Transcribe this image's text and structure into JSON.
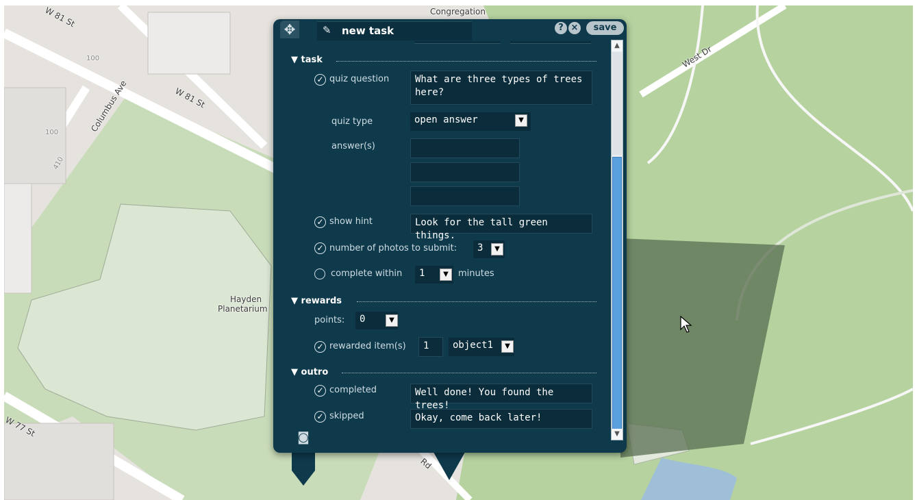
{
  "map": {
    "street_labels": {
      "w81_top": "W 81 St",
      "w81_mid": "W 81 St",
      "columbus": "Columbus Ave",
      "congregation": "Congregation",
      "hayden_line1": "Hayden",
      "hayden_line2": "Planetarium",
      "west_dr": "West Dr",
      "w77": "W 77 St",
      "transverse": "Rd",
      "num_100a": "100",
      "num_100b": "100",
      "num_410": "410"
    }
  },
  "panel": {
    "title": "new task",
    "help_icon": "?",
    "close_icon": "×",
    "save_label": "save",
    "task": {
      "heading": "task",
      "quiz_question_label": "quiz question",
      "quiz_question_value": "What are three types of trees here?",
      "quiz_type_label": "quiz type",
      "quiz_type_value": "open answer",
      "answers_label": "answer(s)",
      "answers": [
        "",
        "",
        ""
      ],
      "show_hint_label": "show hint",
      "show_hint_value": "Look for the tall green things.",
      "photos_label": "number of photos to submit:",
      "photos_value": "3",
      "complete_within_label": "complete within",
      "complete_within_value": "1",
      "minutes_label": "minutes"
    },
    "rewards": {
      "heading": "rewards",
      "points_label": "points:",
      "points_value": "0",
      "rewarded_items_label": "rewarded item(s)",
      "rewarded_items_count": "1",
      "rewarded_items_value": "object1"
    },
    "outro": {
      "heading": "outro",
      "completed_label": "completed",
      "completed_value": "Well done! You found the trees!",
      "skipped_label": "skipped",
      "skipped_value": "Okay, come back later!"
    }
  },
  "colors": {
    "panel_bg": "#0f3a4c",
    "park_green": "#b5d29f",
    "map_grey": "#e6e3df",
    "scroll_thumb": "#5aa0df"
  }
}
